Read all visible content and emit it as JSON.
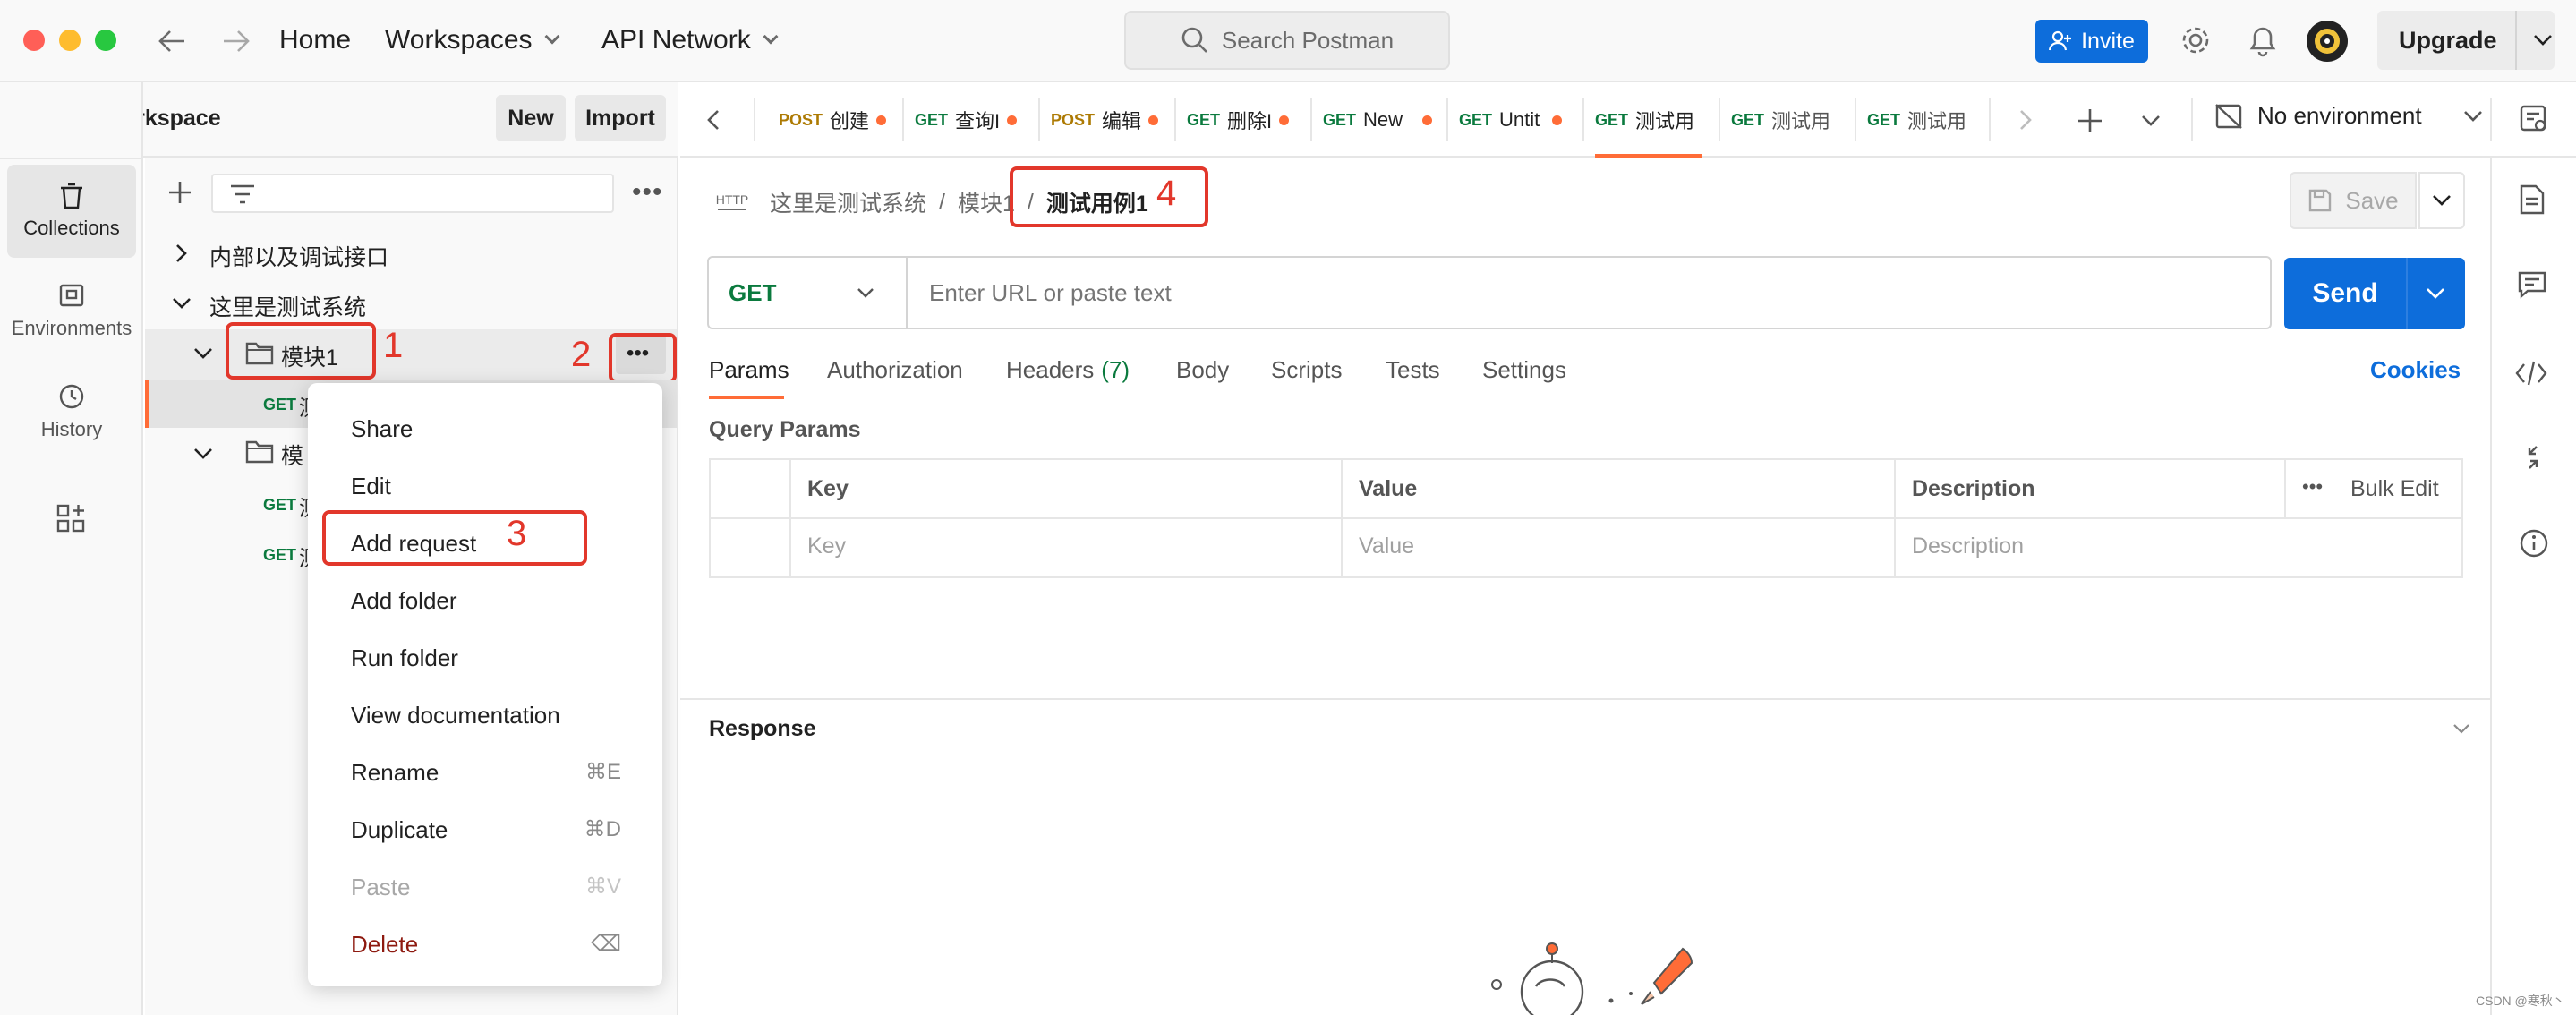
{
  "titlebar": {
    "home": "Home",
    "workspaces": "Workspaces",
    "api_network": "API Network",
    "search_placeholder": "Search Postman",
    "invite": "Invite",
    "upgrade": "Upgrade"
  },
  "workspace": {
    "name": "My Workspace",
    "new_label": "New",
    "import_label": "Import"
  },
  "rail": {
    "items": [
      {
        "label": "Collections"
      },
      {
        "label": "Environments"
      },
      {
        "label": "History"
      }
    ]
  },
  "sidebar": {
    "tree": [
      {
        "label": "内部以及调试接口"
      },
      {
        "label": "这里是测试系统"
      },
      {
        "label": "模块1"
      },
      {
        "label": "模"
      }
    ],
    "get_labels": [
      "GET",
      "GET",
      "GET"
    ],
    "extra_chars": [
      "测",
      "测",
      "测"
    ]
  },
  "annotations": [
    "1",
    "2",
    "3",
    "4"
  ],
  "context_menu": {
    "items": [
      {
        "label": "Share",
        "shortcut": ""
      },
      {
        "label": "Edit",
        "shortcut": ""
      },
      {
        "label": "Add request",
        "shortcut": ""
      },
      {
        "label": "Add folder",
        "shortcut": ""
      },
      {
        "label": "Run folder",
        "shortcut": ""
      },
      {
        "label": "View documentation",
        "shortcut": ""
      },
      {
        "label": "Rename",
        "shortcut": "⌘E"
      },
      {
        "label": "Duplicate",
        "shortcut": "⌘D"
      },
      {
        "label": "Paste",
        "shortcut": "⌘V"
      },
      {
        "label": "Delete",
        "shortcut": "⌫"
      }
    ]
  },
  "tabs": [
    {
      "method": "POST",
      "name": "创建"
    },
    {
      "method": "GET",
      "name": "查询I"
    },
    {
      "method": "POST",
      "name": "编辑"
    },
    {
      "method": "GET",
      "name": "删除I"
    },
    {
      "method": "GET",
      "name": "New"
    },
    {
      "method": "GET",
      "name": "Untit"
    },
    {
      "method": "GET",
      "name": "测试用"
    },
    {
      "method": "GET",
      "name": "测试用"
    },
    {
      "method": "GET",
      "name": "测试用"
    }
  ],
  "environment": "No environment",
  "breadcrumb": {
    "http_icon": "HTTP",
    "parts": [
      "这里是测试系统",
      "模块1",
      "测试用例1"
    ],
    "separator": "/"
  },
  "save_label": "Save",
  "request": {
    "method": "GET",
    "url_placeholder": "Enter URL or paste text",
    "send": "Send"
  },
  "param_tabs": {
    "params": "Params",
    "authorization": "Authorization",
    "headers": "Headers",
    "headers_count": "(7)",
    "body": "Body",
    "scripts": "Scripts",
    "tests": "Tests",
    "settings": "Settings",
    "cookies": "Cookies"
  },
  "query_params": {
    "title": "Query Params",
    "headers": [
      "Key",
      "Value",
      "Description"
    ],
    "bulk_edit": "Bulk Edit",
    "placeholders": [
      "Key",
      "Value",
      "Description"
    ]
  },
  "response_label": "Response",
  "watermark": "CSDN @寒秋丶",
  "colors": {
    "accent": "#0d6ddb",
    "post": "#ad7a03",
    "get": "#0b7a3e",
    "modified_dot": "#ff6c37",
    "annotation": "#e2372b",
    "delete": "#8e1a10"
  }
}
